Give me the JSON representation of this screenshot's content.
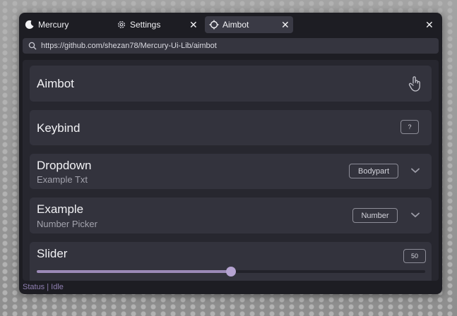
{
  "tabs": [
    {
      "label": "Mercury",
      "icon": "moon-icon"
    },
    {
      "label": "Settings",
      "icon": "gear-icon",
      "close": "✕"
    },
    {
      "label": "Aimbot",
      "icon": "crosshair-icon",
      "close": "✕",
      "active": true
    }
  ],
  "window": {
    "close": "✕"
  },
  "url": "https://github.com/shezan78/Mercury-Ui-Lib/aimbot",
  "cards": {
    "aimbot": {
      "title": "Aimbot",
      "icon": "pointer-hand-icon"
    },
    "keybind": {
      "title": "Keybind",
      "key": "?"
    },
    "dropdown": {
      "title": "Dropdown",
      "subtitle": "Example Txt",
      "value": "Bodypart"
    },
    "example": {
      "title": "Example",
      "subtitle": "Number Picker",
      "value": "Number"
    },
    "slider": {
      "title": "Slider",
      "value": "50",
      "min": 0,
      "max": 100,
      "current": 50
    }
  },
  "status": "Status | Idle",
  "colors": {
    "accent": "#9c8ab8",
    "window": "#1d1d23",
    "card": "#33333d",
    "status": "#8f7fb1"
  }
}
